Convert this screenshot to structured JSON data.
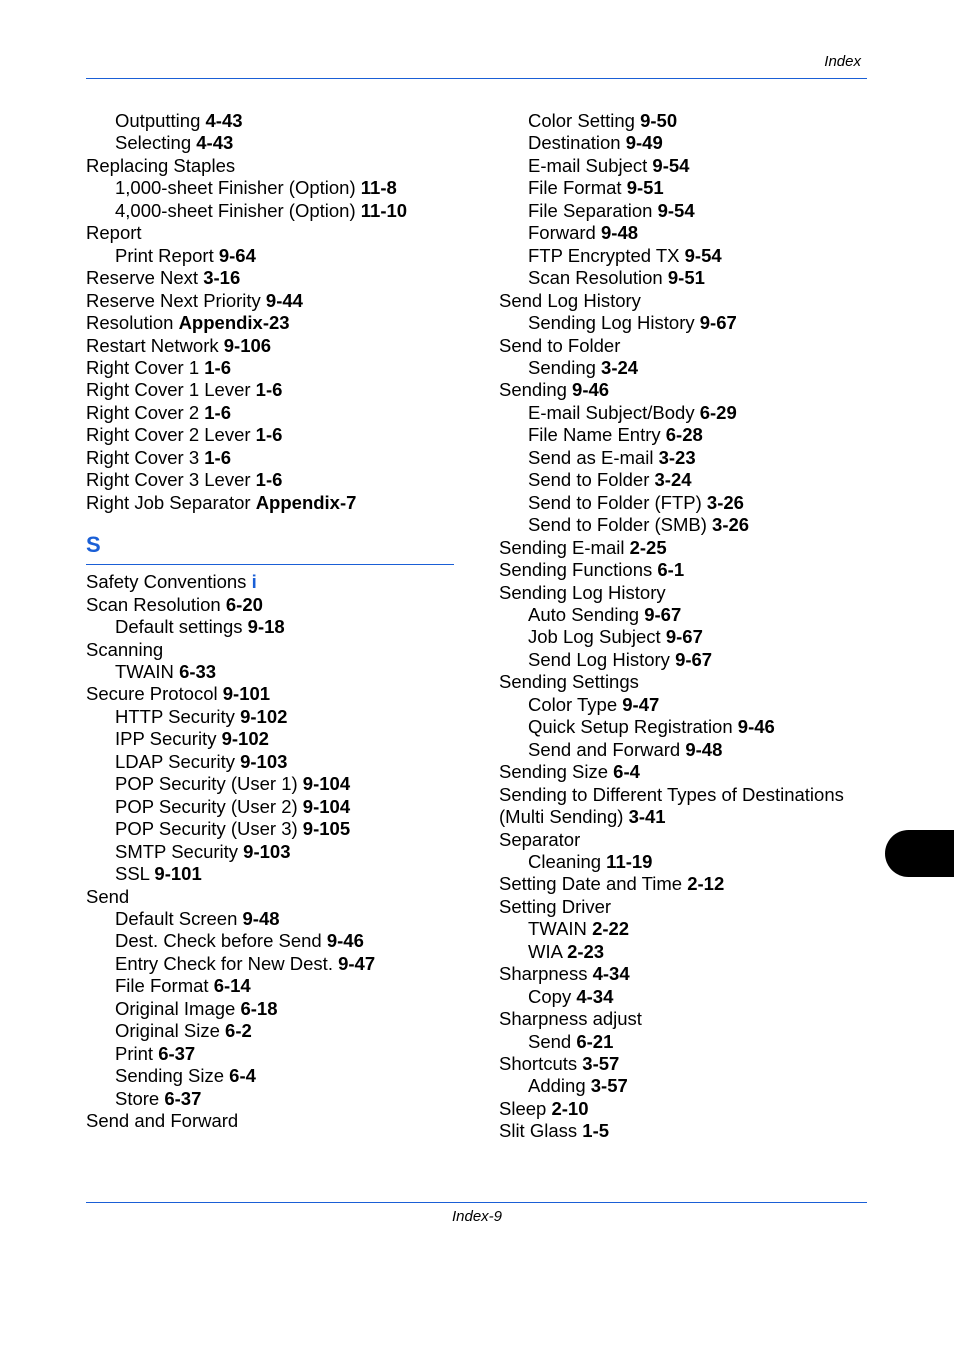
{
  "header": {
    "title": "Index"
  },
  "footer": {
    "page": "Index-9"
  },
  "left_column": {
    "entries_before": [
      {
        "term": "Outputting",
        "ref": "4-43",
        "sub": true
      },
      {
        "term": "Selecting",
        "ref": "4-43",
        "sub": true
      },
      {
        "term": "Replacing Staples",
        "ref": "",
        "sub": false
      },
      {
        "term": "1,000-sheet Finisher (Option)",
        "ref": "11-8",
        "sub": true
      },
      {
        "term": "4,000-sheet Finisher (Option)",
        "ref": "11-10",
        "sub": true
      },
      {
        "term": "Report",
        "ref": "",
        "sub": false
      },
      {
        "term": "Print Report",
        "ref": "9-64",
        "sub": true
      },
      {
        "term": "Reserve Next",
        "ref": "3-16",
        "sub": false
      },
      {
        "term": "Reserve Next Priority",
        "ref": "9-44",
        "sub": false
      },
      {
        "term": "Resolution",
        "ref": "Appendix-23",
        "sub": false
      },
      {
        "term": "Restart Network",
        "ref": "9-106",
        "sub": false
      },
      {
        "term": "Right Cover 1",
        "ref": "1-6",
        "sub": false
      },
      {
        "term": "Right Cover 1 Lever",
        "ref": "1-6",
        "sub": false
      },
      {
        "term": "Right Cover 2",
        "ref": "1-6",
        "sub": false
      },
      {
        "term": "Right Cover 2 Lever",
        "ref": "1-6",
        "sub": false
      },
      {
        "term": "Right Cover 3",
        "ref": "1-6",
        "sub": false
      },
      {
        "term": "Right Cover 3 Lever",
        "ref": "1-6",
        "sub": false
      },
      {
        "term": "Right Job Separator",
        "ref": "Appendix-7",
        "sub": false
      }
    ],
    "section_letter": "S",
    "entries_after": [
      {
        "term": "Safety Conventions",
        "ref": "i",
        "sub": false,
        "link": true
      },
      {
        "term": "Scan Resolution",
        "ref": "6-20",
        "sub": false
      },
      {
        "term": "Default settings",
        "ref": "9-18",
        "sub": true
      },
      {
        "term": "Scanning",
        "ref": "",
        "sub": false
      },
      {
        "term": "TWAIN",
        "ref": "6-33",
        "sub": true
      },
      {
        "term": "Secure Protocol",
        "ref": "9-101",
        "sub": false
      },
      {
        "term": "HTTP Security",
        "ref": "9-102",
        "sub": true
      },
      {
        "term": "IPP Security",
        "ref": "9-102",
        "sub": true
      },
      {
        "term": "LDAP Security",
        "ref": "9-103",
        "sub": true
      },
      {
        "term": "POP Security (User 1)",
        "ref": "9-104",
        "sub": true
      },
      {
        "term": "POP Security (User 2)",
        "ref": "9-104",
        "sub": true
      },
      {
        "term": "POP Security (User 3)",
        "ref": "9-105",
        "sub": true
      },
      {
        "term": "SMTP Security",
        "ref": "9-103",
        "sub": true
      },
      {
        "term": "SSL",
        "ref": "9-101",
        "sub": true
      },
      {
        "term": "Send",
        "ref": "",
        "sub": false
      },
      {
        "term": "Default Screen",
        "ref": "9-48",
        "sub": true
      },
      {
        "term": "Dest. Check before Send",
        "ref": "9-46",
        "sub": true
      },
      {
        "term": "Entry Check for New Dest.",
        "ref": "9-47",
        "sub": true
      },
      {
        "term": "File Format",
        "ref": "6-14",
        "sub": true
      },
      {
        "term": "Original Image",
        "ref": "6-18",
        "sub": true
      },
      {
        "term": "Original Size",
        "ref": "6-2",
        "sub": true
      },
      {
        "term": "Print",
        "ref": "6-37",
        "sub": true
      },
      {
        "term": "Sending Size",
        "ref": "6-4",
        "sub": true
      },
      {
        "term": "Store",
        "ref": "6-37",
        "sub": true
      },
      {
        "term": "Send and Forward",
        "ref": "",
        "sub": false
      }
    ]
  },
  "right_column": {
    "entries": [
      {
        "term": "Color Setting",
        "ref": "9-50",
        "sub": true
      },
      {
        "term": "Destination",
        "ref": "9-49",
        "sub": true
      },
      {
        "term": "E-mail Subject",
        "ref": "9-54",
        "sub": true
      },
      {
        "term": "File Format",
        "ref": "9-51",
        "sub": true
      },
      {
        "term": "File Separation",
        "ref": "9-54",
        "sub": true
      },
      {
        "term": "Forward",
        "ref": "9-48",
        "sub": true
      },
      {
        "term": "FTP Encrypted TX",
        "ref": "9-54",
        "sub": true
      },
      {
        "term": "Scan Resolution",
        "ref": "9-51",
        "sub": true
      },
      {
        "term": "Send Log History",
        "ref": "",
        "sub": false
      },
      {
        "term": "Sending Log History",
        "ref": "9-67",
        "sub": true
      },
      {
        "term": "Send to Folder",
        "ref": "",
        "sub": false
      },
      {
        "term": "Sending",
        "ref": "3-24",
        "sub": true
      },
      {
        "term": "Sending",
        "ref": "9-46",
        "sub": false
      },
      {
        "term": "E-mail Subject/Body",
        "ref": "6-29",
        "sub": true
      },
      {
        "term": "File Name Entry",
        "ref": "6-28",
        "sub": true
      },
      {
        "term": "Send as E-mail",
        "ref": "3-23",
        "sub": true
      },
      {
        "term": "Send to Folder",
        "ref": "3-24",
        "sub": true
      },
      {
        "term": "Send to Folder (FTP)",
        "ref": "3-26",
        "sub": true
      },
      {
        "term": "Send to Folder (SMB)",
        "ref": "3-26",
        "sub": true
      },
      {
        "term": "Sending E-mail",
        "ref": "2-25",
        "sub": false
      },
      {
        "term": "Sending Functions",
        "ref": "6-1",
        "sub": false
      },
      {
        "term": "Sending Log History",
        "ref": "",
        "sub": false
      },
      {
        "term": "Auto Sending",
        "ref": "9-67",
        "sub": true
      },
      {
        "term": "Job Log Subject",
        "ref": "9-67",
        "sub": true
      },
      {
        "term": "Send Log History",
        "ref": "9-67",
        "sub": true
      },
      {
        "term": "Sending Settings",
        "ref": "",
        "sub": false
      },
      {
        "term": "Color Type",
        "ref": "9-47",
        "sub": true
      },
      {
        "term": "Quick Setup Registration",
        "ref": "9-46",
        "sub": true
      },
      {
        "term": "Send and Forward",
        "ref": "9-48",
        "sub": true
      },
      {
        "term": "Sending Size",
        "ref": "6-4",
        "sub": false
      },
      {
        "term": "Sending to Different Types of Destinations",
        "ref": "",
        "sub": false
      },
      {
        "term": "(Multi Sending)",
        "ref": "3-41",
        "sub": false
      },
      {
        "term": "Separator",
        "ref": "",
        "sub": false
      },
      {
        "term": "Cleaning",
        "ref": "11-19",
        "sub": true
      },
      {
        "term": "Setting Date and Time",
        "ref": "2-12",
        "sub": false
      },
      {
        "term": "Setting Driver",
        "ref": "",
        "sub": false
      },
      {
        "term": "TWAIN",
        "ref": "2-22",
        "sub": true
      },
      {
        "term": "WIA",
        "ref": "2-23",
        "sub": true
      },
      {
        "term": "Sharpness",
        "ref": "4-34",
        "sub": false
      },
      {
        "term": "Copy",
        "ref": "4-34",
        "sub": true
      },
      {
        "term": "Sharpness adjust",
        "ref": "",
        "sub": false
      },
      {
        "term": "Send",
        "ref": "6-21",
        "sub": true
      },
      {
        "term": "Shortcuts",
        "ref": "3-57",
        "sub": false
      },
      {
        "term": "Adding",
        "ref": "3-57",
        "sub": true
      },
      {
        "term": "Sleep",
        "ref": "2-10",
        "sub": false
      },
      {
        "term": "Slit Glass",
        "ref": "1-5",
        "sub": false
      }
    ]
  },
  "colors": {
    "accent": "#1a5fd6",
    "text": "#000000",
    "tab": "#000000"
  }
}
